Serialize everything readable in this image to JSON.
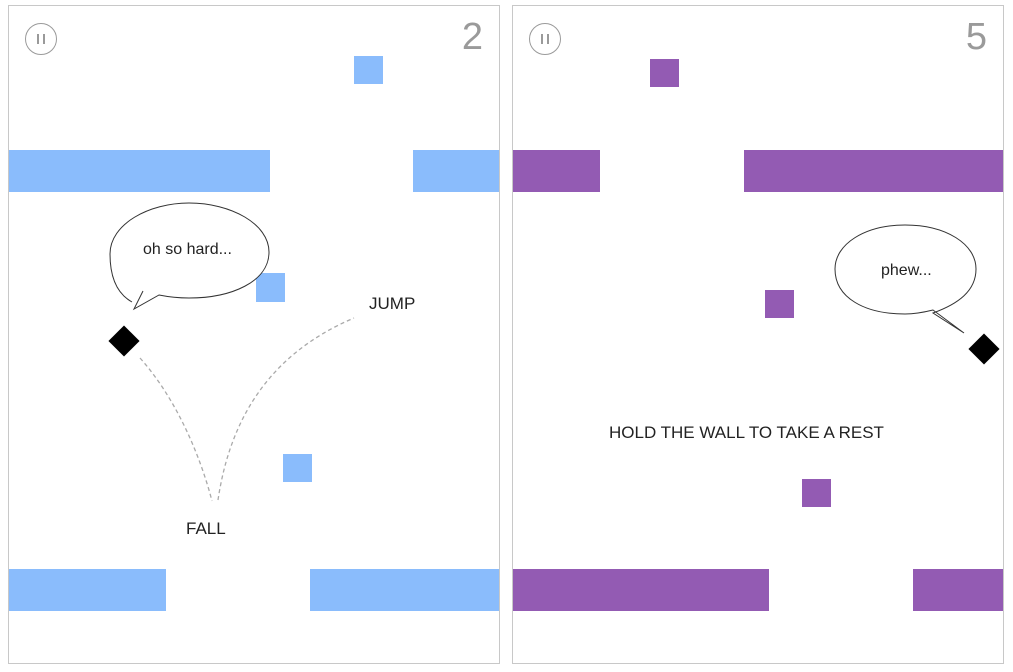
{
  "colors": {
    "level_blue": "#8abcfc",
    "level_purple": "#935bb3",
    "player": "#000000",
    "ui_gray": "#9a9a9a",
    "panel_border": "#c8c8c8"
  },
  "panels": [
    {
      "score": "2",
      "pause_icon": "pause-icon",
      "speech_bubble": "oh so hard...",
      "hint_jump": "JUMP",
      "hint_fall": "FALL"
    },
    {
      "score": "5",
      "pause_icon": "pause-icon",
      "speech_bubble": "phew...",
      "hint_center": "HOLD THE WALL TO TAKE A REST"
    }
  ]
}
